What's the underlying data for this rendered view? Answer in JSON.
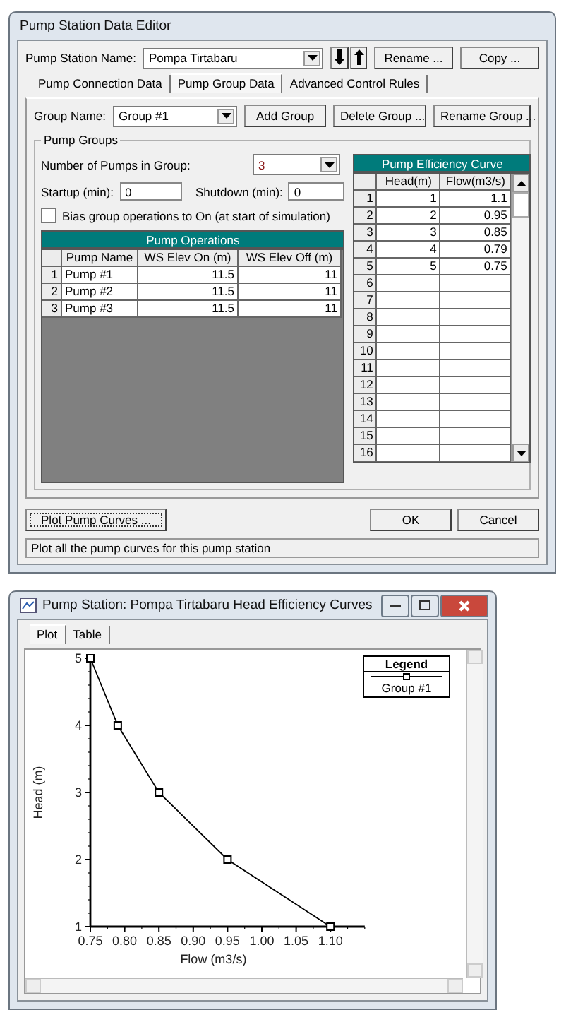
{
  "editor": {
    "title": "Pump Station Data Editor",
    "station_label": "Pump Station Name:",
    "station_name": "Pompa Tirtabaru",
    "station_buttons": [
      "Rename ...",
      "Copy ..."
    ],
    "tabs": [
      {
        "label": "Pump Connection Data",
        "selected": false
      },
      {
        "label": "Pump Group Data",
        "selected": true
      },
      {
        "label": "Advanced Control Rules",
        "selected": false
      }
    ],
    "group_label": "Group Name:",
    "group_name": "Group #1",
    "group_buttons": [
      "Add Group",
      "Delete Group ...",
      "Rename Group ..."
    ],
    "groupbox_title": "Pump Groups",
    "pumps_label": "Number of Pumps in Group:",
    "pumps_value": "3",
    "startup_label": "Startup (min):",
    "startup_value": "0",
    "shutdown_label": "Shutdown (min):",
    "shutdown_value": "0",
    "bias": {
      "label": "Bias group operations to On (at start of simulation)",
      "checked": false
    },
    "operations": {
      "title": "Pump Operations",
      "columns": [
        "Pump Name",
        "WS Elev On (m)",
        "WS Elev Off (m)"
      ],
      "rows": [
        {
          "index": "1",
          "cells": [
            "Pump #1",
            "11.5",
            "11"
          ]
        },
        {
          "index": "2",
          "cells": [
            "Pump #2",
            "11.5",
            "11"
          ]
        },
        {
          "index": "3",
          "cells": [
            "Pump #3",
            "11.5",
            "11"
          ]
        }
      ]
    },
    "efficiency": {
      "title": "Pump Efficiency Curve",
      "columns": [
        "Head(m)",
        "Flow(m3/s)"
      ],
      "rows": [
        {
          "index": "1",
          "cells": [
            "1",
            "1.1"
          ]
        },
        {
          "index": "2",
          "cells": [
            "2",
            "0.95"
          ]
        },
        {
          "index": "3",
          "cells": [
            "3",
            "0.85"
          ]
        },
        {
          "index": "4",
          "cells": [
            "4",
            "0.79"
          ]
        },
        {
          "index": "5",
          "cells": [
            "5",
            "0.75"
          ]
        },
        {
          "index": "6"
        },
        {
          "index": "7"
        },
        {
          "index": "8"
        },
        {
          "index": "9"
        },
        {
          "index": "10"
        },
        {
          "index": "11"
        },
        {
          "index": "12"
        },
        {
          "index": "13"
        },
        {
          "index": "14"
        },
        {
          "index": "15"
        },
        {
          "index": "16"
        }
      ]
    },
    "plot_button": "Plot Pump Curves ...",
    "ok_button": "OK",
    "cancel_button": "Cancel",
    "status": "Plot all the pump curves for this pump station"
  },
  "plot_window": {
    "title": "Pump Station: Pompa Tirtabaru Head Efficiency Curves",
    "tabs": [
      {
        "label": "Plot",
        "selected": true
      },
      {
        "label": "Table",
        "selected": false
      }
    ],
    "legend": {
      "title": "Legend"
    },
    "chart_data": {
      "type": "line",
      "xlabel": "Flow  (m3/s)",
      "ylabel": "Head  (m)",
      "x": [
        1.1,
        0.95,
        0.85,
        0.79,
        0.75
      ],
      "series": [
        {
          "name": "Group #1",
          "color": "#000000",
          "marker": "square",
          "values": [
            1,
            2,
            3,
            4,
            5
          ]
        }
      ],
      "xlim": [
        0.75,
        1.15
      ],
      "ylim": [
        1,
        5
      ],
      "xticks": [
        {
          "value": 0.75,
          "label": "0.75"
        },
        {
          "value": 0.8,
          "label": "0.80"
        },
        {
          "value": 0.85,
          "label": "0.85"
        },
        {
          "value": 0.9,
          "label": "0.90"
        },
        {
          "value": 0.95,
          "label": "0.95"
        },
        {
          "value": 1.0,
          "label": "1.00"
        },
        {
          "value": 1.05,
          "label": "1.05"
        },
        {
          "value": 1.1,
          "label": "1.10"
        }
      ],
      "yticks": [
        1,
        2,
        3,
        4,
        5
      ]
    }
  }
}
